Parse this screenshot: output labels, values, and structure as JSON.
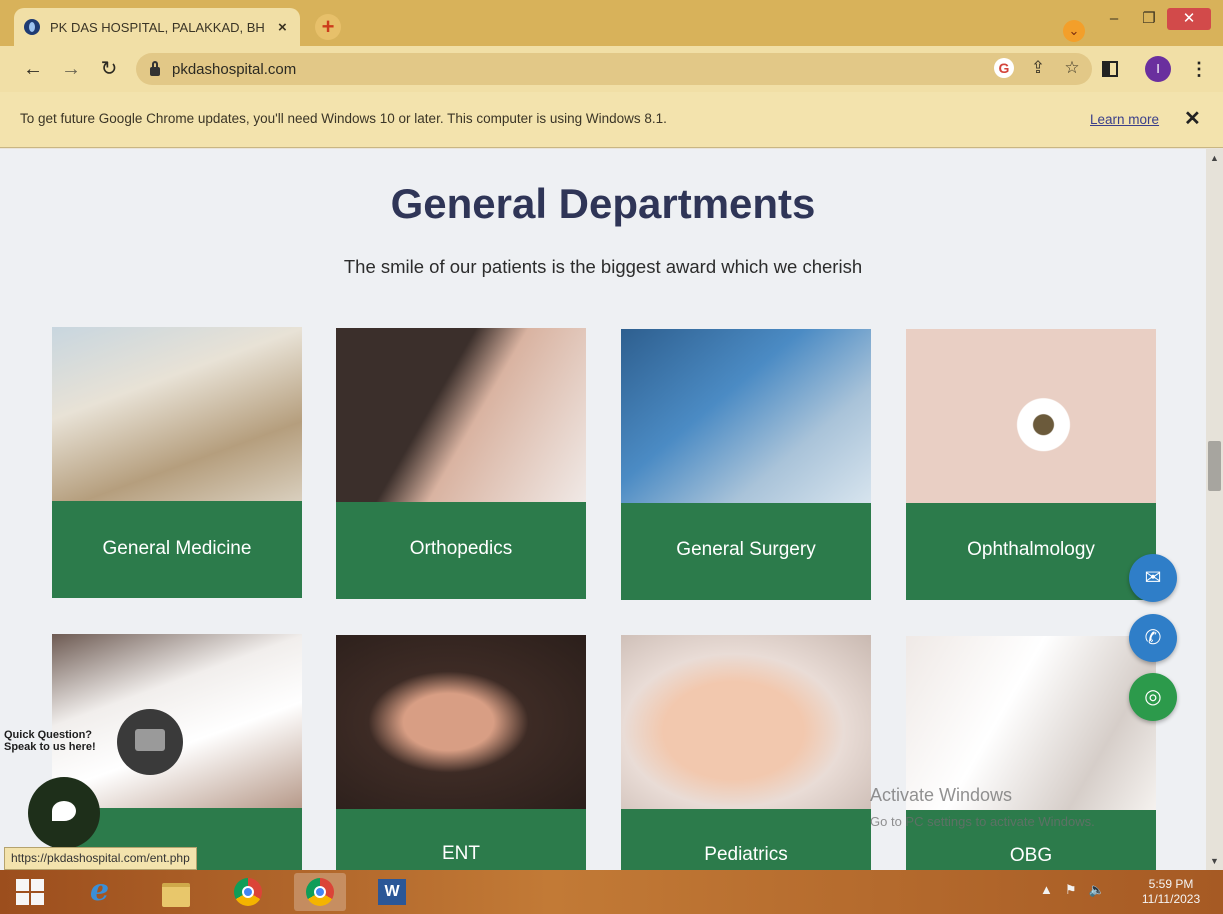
{
  "browser": {
    "tab_title": "PK DAS HOSPITAL, PALAKKAD, BH",
    "tab_close": "×",
    "new_tab": "+",
    "url": "pkdashospital.com",
    "profile_initial": "I",
    "infobar": {
      "message": "To get future Google Chrome updates, you'll need Windows 10 or later. This computer is using Windows 8.1.",
      "link": "Learn more",
      "close": "✕"
    },
    "status_url": "https://pkdashospital.com/ent.php"
  },
  "page": {
    "heading": "General Departments",
    "subheading": "The smile of our patients is the biggest award which we cherish",
    "departments": [
      {
        "label": "General Medicine",
        "icon": "pills-photo"
      },
      {
        "label": "Orthopedics",
        "icon": "knee-photo"
      },
      {
        "label": "General Surgery",
        "icon": "surgeons-photo"
      },
      {
        "label": "Ophthalmology",
        "icon": "eye-photo"
      },
      {
        "label": "",
        "icon": "doctor-photo"
      },
      {
        "label": "ENT",
        "icon": "ear-photo"
      },
      {
        "label": "Pediatrics",
        "icon": "baby-photo"
      },
      {
        "label": "OBG",
        "icon": "pregnancy-photo"
      }
    ],
    "chat": {
      "quick_line1": "Quick Question?",
      "quick_line2": "Speak to us here!"
    },
    "watermark": {
      "line1": "Activate Windows",
      "line2": "Go to PC settings to activate Windows."
    }
  },
  "taskbar": {
    "time": "5:59 PM",
    "date": "11/11/2023"
  },
  "colors": {
    "card_green": "#2c7b4b",
    "heading_navy": "#2f3557",
    "contact_blue": "#2f7ec8",
    "whatsapp_green": "#2c9a4b"
  }
}
